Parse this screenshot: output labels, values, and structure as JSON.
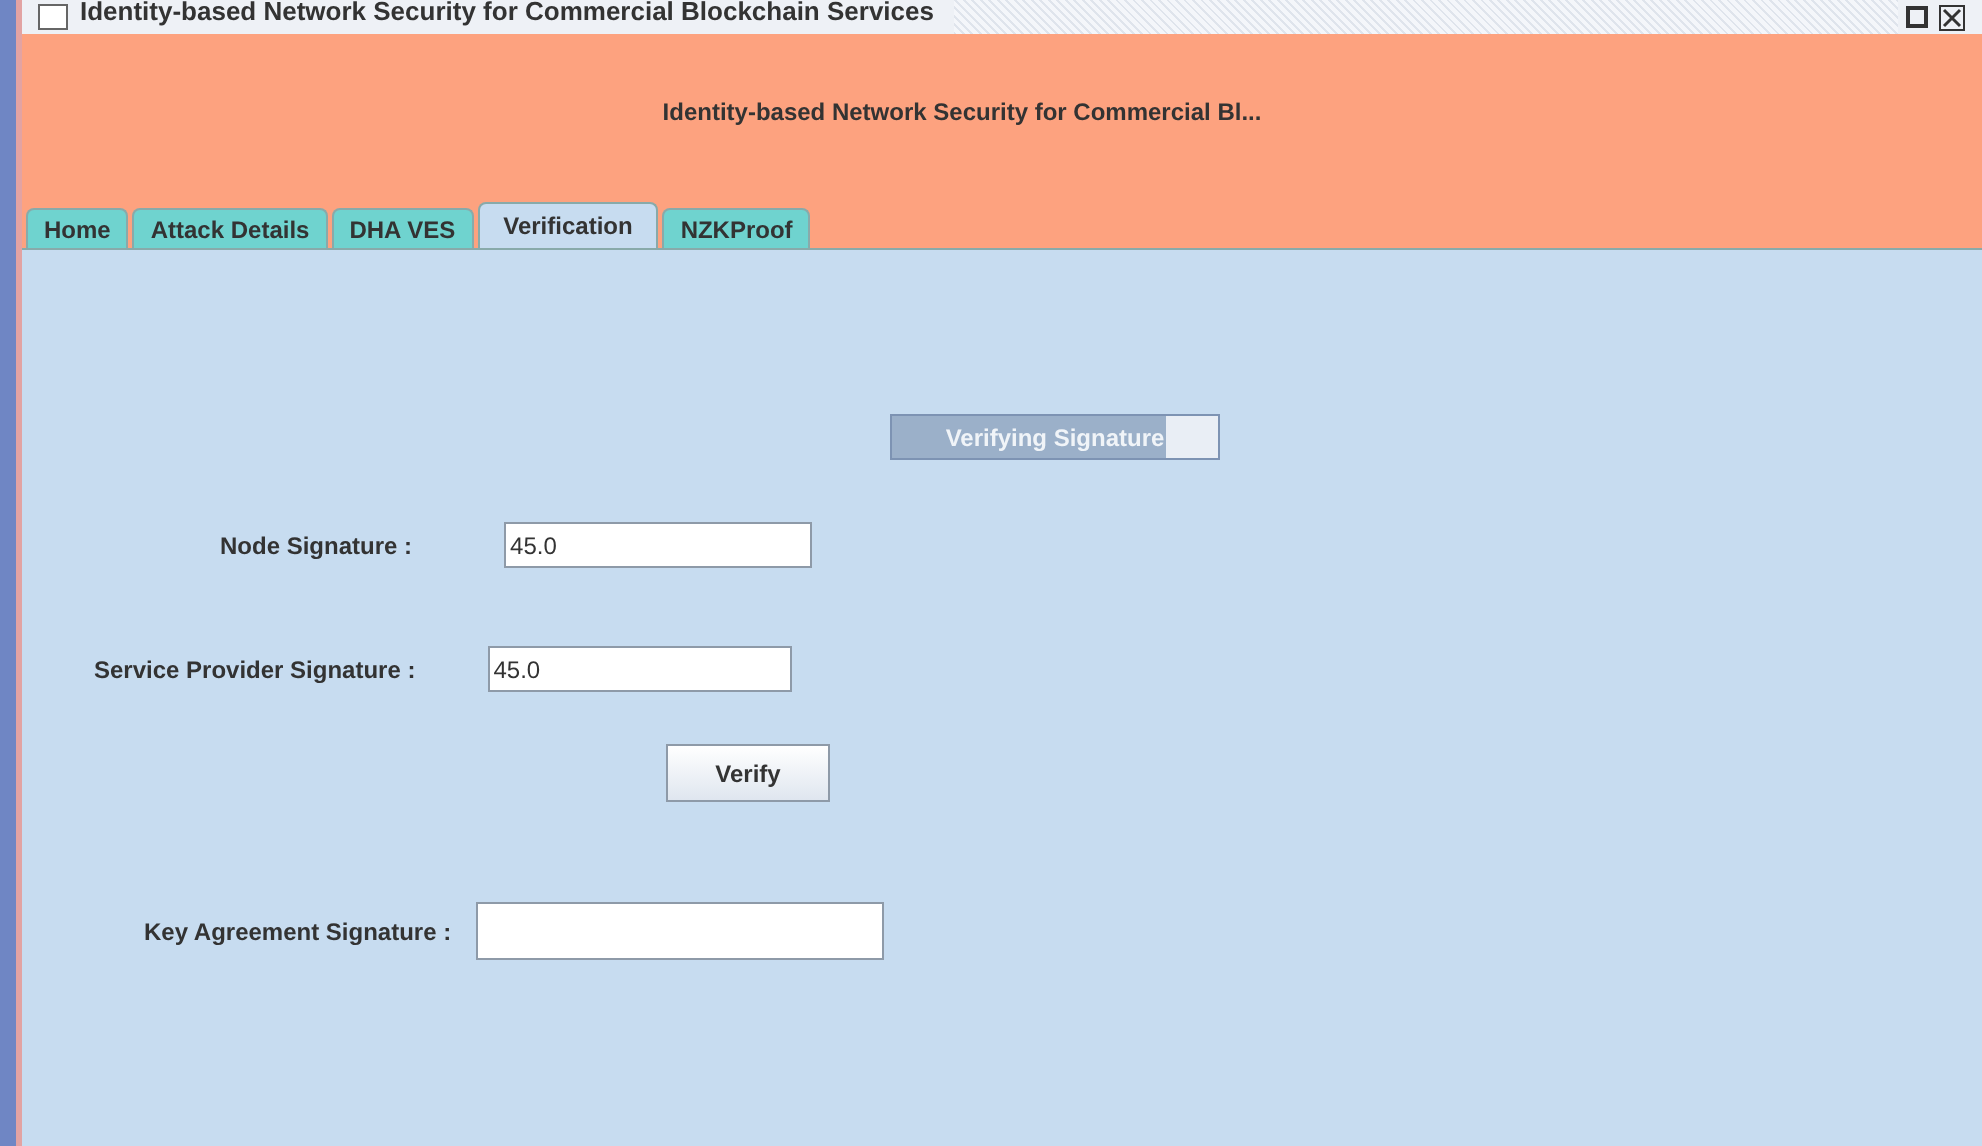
{
  "window": {
    "title": "Identity-based Network Security for Commercial Blockchain Services"
  },
  "header": {
    "title": "Identity-based Network Security for Commercial Bl..."
  },
  "tabs": [
    {
      "label": "Home",
      "selected": false
    },
    {
      "label": "Attack Details",
      "selected": false
    },
    {
      "label": "DHA VES",
      "selected": false
    },
    {
      "label": "Verification",
      "selected": true
    },
    {
      "label": "NZKProof",
      "selected": false
    }
  ],
  "progress": {
    "label": "Verifying Signature",
    "level": 0.84
  },
  "fields": [
    {
      "label": "Node Signature :",
      "value": "45.0"
    },
    {
      "label": "Service Provider Signature :",
      "value": "45.0"
    }
  ],
  "verify_button": "Verify",
  "key_field": {
    "label": "Key Agreement Signature :"
  }
}
